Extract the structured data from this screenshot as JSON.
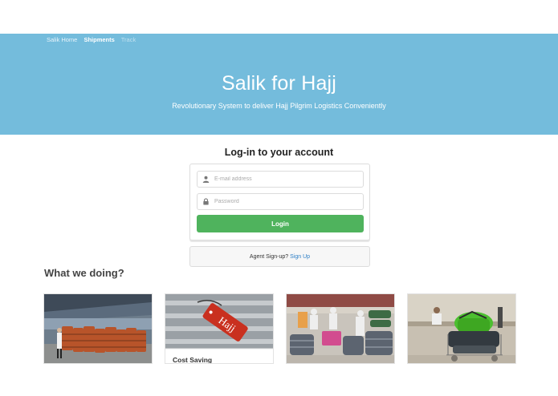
{
  "nav": {
    "items": [
      {
        "label": "Salik Home"
      },
      {
        "label": "Shipments"
      },
      {
        "label": "Track"
      }
    ]
  },
  "hero": {
    "title": "Salik for Hajj",
    "subtitle": "Revolutionary System to deliver Hajj Pilgrim Logistics Conveniently",
    "background": "#74bcdc"
  },
  "login": {
    "heading": "Log-in to your account",
    "email_placeholder": "E-mail address",
    "email_value": "",
    "password_placeholder": "Password",
    "password_value": "",
    "button_label": "Login",
    "button_color": "#4fb35d"
  },
  "signup": {
    "prompt": "Agent Sign-up?",
    "link": "Sign Up"
  },
  "features": {
    "title": "What we doing?",
    "cards": [
      {
        "caption": "",
        "image": "luggage-carts-photo"
      },
      {
        "caption": "Cost Saving",
        "image": "hajj-luggage-tag-photo"
      },
      {
        "caption": "",
        "image": "pilgrims-luggage-crowd-photo"
      },
      {
        "caption": "",
        "image": "bags-on-cart-photo"
      }
    ]
  }
}
